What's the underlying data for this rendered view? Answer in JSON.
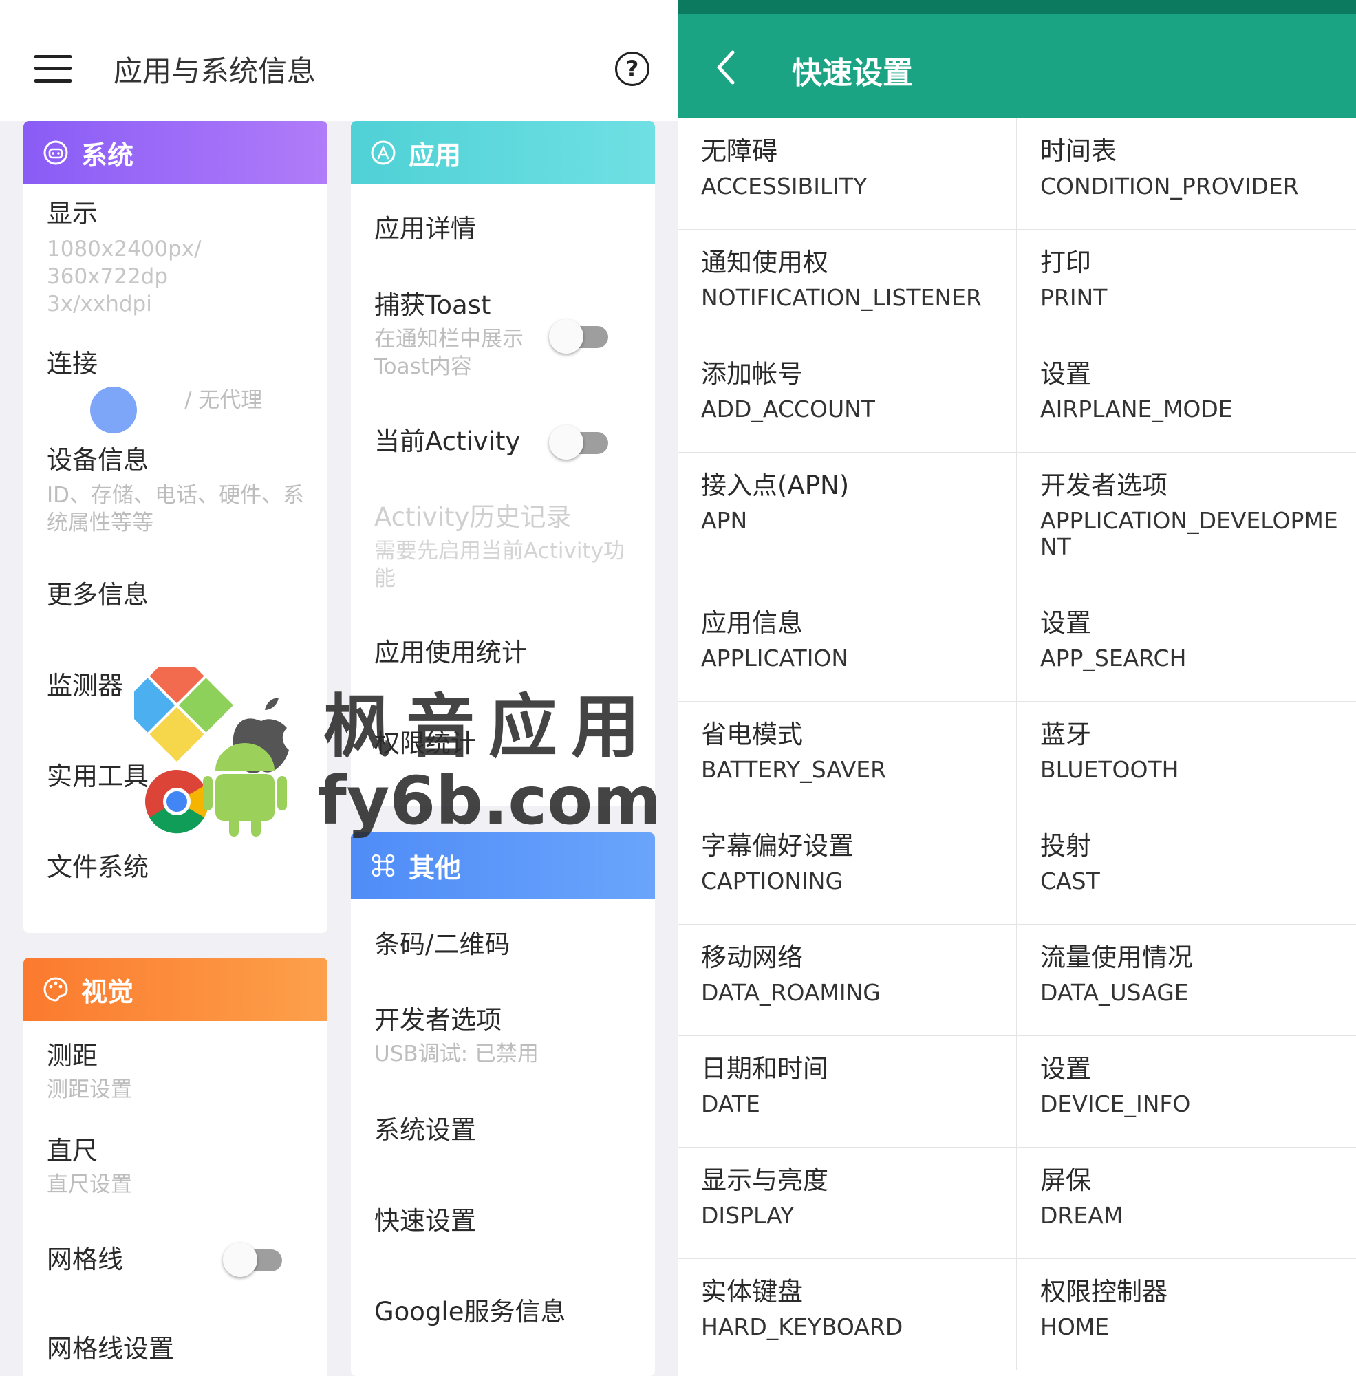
{
  "left_panel": {
    "title": "应用与系统信息",
    "help_icon": "?",
    "system_card": {
      "header": "系统",
      "items": [
        {
          "title": "显示",
          "subtitle": "1080x2400px/\n360x722dp\n3x/xxhdpi"
        },
        {
          "title": "连接",
          "subtitle": "/ 无代理"
        },
        {
          "title": "设备信息",
          "subtitle": "ID、存储、电话、硬件、系统属性等等"
        },
        {
          "title": "更多信息"
        },
        {
          "title": "监测器"
        },
        {
          "title": "实用工具"
        },
        {
          "title": "文件系统"
        }
      ]
    },
    "app_card": {
      "header": "应用",
      "items": [
        {
          "title": "应用详情"
        },
        {
          "title": "捕获Toast",
          "subtitle": "在通知栏中展示Toast内容",
          "toggle": false
        },
        {
          "title": "当前Activity",
          "toggle": false
        },
        {
          "title": "Activity历史记录",
          "subtitle": "需要先启用当前Activity功能",
          "disabled": true
        },
        {
          "title": "应用使用统计"
        },
        {
          "title": "权限统计"
        }
      ]
    },
    "vision_card": {
      "header": "视觉",
      "items": [
        {
          "title": "测距",
          "subtitle": "测距设置"
        },
        {
          "title": "直尺",
          "subtitle": "直尺设置"
        },
        {
          "title": "网格线",
          "toggle": false
        },
        {
          "title": "网格线设置"
        }
      ]
    },
    "other_card": {
      "header": "其他",
      "items": [
        {
          "title": "条码/二维码"
        },
        {
          "title": "开发者选项",
          "subtitle": "USB调试: 已禁用"
        },
        {
          "title": "系统设置"
        },
        {
          "title": "快速设置"
        },
        {
          "title": "Google服务信息"
        }
      ]
    },
    "watermark": {
      "line1": "枫音应用",
      "line2": "fy6b.com"
    }
  },
  "right_panel": {
    "title": "快速设置",
    "rows": [
      [
        {
          "zh": "无障碍",
          "en": "ACCESSIBILITY"
        },
        {
          "zh": "时间表",
          "en": "CONDITION_PROVIDER"
        }
      ],
      [
        {
          "zh": "通知使用权",
          "en": "NOTIFICATION_LISTENER"
        },
        {
          "zh": "打印",
          "en": "PRINT"
        }
      ],
      [
        {
          "zh": "添加帐号",
          "en": "ADD_ACCOUNT"
        },
        {
          "zh": "设置",
          "en": "AIRPLANE_MODE"
        }
      ],
      [
        {
          "zh": "接入点(APN)",
          "en": "APN"
        },
        {
          "zh": "开发者选项",
          "en": "APPLICATION_DEVELOPMENT"
        }
      ],
      [
        {
          "zh": "应用信息",
          "en": "APPLICATION"
        },
        {
          "zh": "设置",
          "en": "APP_SEARCH"
        }
      ],
      [
        {
          "zh": "省电模式",
          "en": "BATTERY_SAVER"
        },
        {
          "zh": "蓝牙",
          "en": "BLUETOOTH"
        }
      ],
      [
        {
          "zh": "字幕偏好设置",
          "en": "CAPTIONING"
        },
        {
          "zh": "投射",
          "en": "CAST"
        }
      ],
      [
        {
          "zh": "移动网络",
          "en": "DATA_ROAMING"
        },
        {
          "zh": "流量使用情况",
          "en": "DATA_USAGE"
        }
      ],
      [
        {
          "zh": "日期和时间",
          "en": "DATE"
        },
        {
          "zh": "设置",
          "en": "DEVICE_INFO"
        }
      ],
      [
        {
          "zh": "显示与亮度",
          "en": "DISPLAY"
        },
        {
          "zh": "屏保",
          "en": "DREAM"
        }
      ],
      [
        {
          "zh": "实体键盘",
          "en": "HARD_KEYBOARD"
        },
        {
          "zh": "权限控制器",
          "en": "HOME"
        }
      ]
    ]
  },
  "colors": {
    "system_header": "#8a5cf6",
    "app_header": "#4fd1d5",
    "vision_header": "#fb7a2e",
    "other_header": "#4f8cf7",
    "quick_settings_header": "#1ba484"
  }
}
